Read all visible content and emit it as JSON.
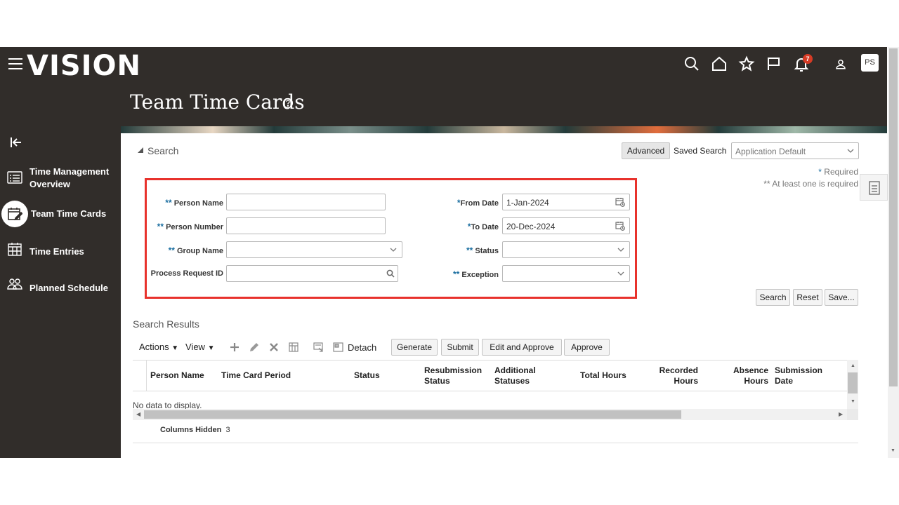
{
  "app": {
    "logo": "VISION",
    "page_title": "Team Time Cards",
    "notification_count": "7",
    "user_initials": "PS"
  },
  "sidebar": {
    "items": [
      {
        "label_line1": "Time Management",
        "label_line2": "Overview",
        "icon": "list-icon"
      },
      {
        "label": "Team Time Cards",
        "icon": "calendar-edit-icon",
        "active": true
      },
      {
        "label": "Time Entries",
        "icon": "calendar-grid-icon"
      },
      {
        "label": "Planned Schedule",
        "icon": "people-icon"
      }
    ]
  },
  "search": {
    "section_label": "Search",
    "advanced_label": "Advanced",
    "saved_search_label": "Saved Search",
    "saved_search_value": "Application Default",
    "required_note": "Required",
    "at_least_one_note": "** At least one is required",
    "fields": {
      "person_name": {
        "label": "Person Name",
        "marker": "**",
        "value": ""
      },
      "person_number": {
        "label": "Person Number",
        "marker": "**",
        "value": ""
      },
      "group_name": {
        "label": "Group Name",
        "marker": "**",
        "value": ""
      },
      "process_request_id": {
        "label": "Process Request ID",
        "value": ""
      },
      "from_date": {
        "label": "From Date",
        "marker": "*",
        "value": "1-Jan-2024"
      },
      "to_date": {
        "label": "To Date",
        "marker": "*",
        "value": "20-Dec-2024"
      },
      "status": {
        "label": "Status",
        "marker": "**",
        "value": ""
      },
      "exception": {
        "label": "Exception",
        "marker": "**",
        "value": ""
      }
    },
    "buttons": {
      "search": "Search",
      "reset": "Reset",
      "save": "Save..."
    }
  },
  "results": {
    "title": "Search Results",
    "toolbar": {
      "actions": "Actions",
      "view": "View",
      "detach": "Detach",
      "generate": "Generate",
      "submit": "Submit",
      "edit_approve": "Edit and Approve",
      "approve": "Approve"
    },
    "columns": [
      {
        "line1": "Person Name",
        "line2": ""
      },
      {
        "line1": "Time Card Period",
        "line2": ""
      },
      {
        "line1": "Status",
        "line2": ""
      },
      {
        "line1": "Resubmission",
        "line2": "Status"
      },
      {
        "line1": "Additional",
        "line2": "Statuses"
      },
      {
        "line1": "Total Hours",
        "line2": ""
      },
      {
        "line1": "Recorded",
        "line2": "Hours"
      },
      {
        "line1": "Absence",
        "line2": "Hours"
      },
      {
        "line1": "Submission",
        "line2": "Date"
      }
    ],
    "empty_text": "No data to display.",
    "columns_hidden_label": "Columns Hidden",
    "columns_hidden_count": "3"
  }
}
